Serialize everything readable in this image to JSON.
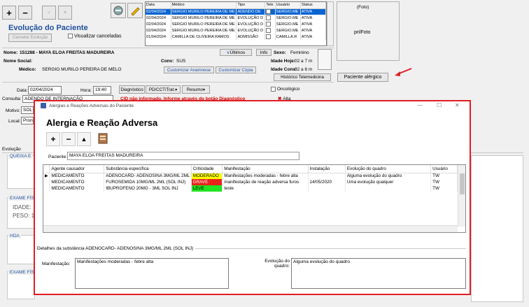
{
  "toolbar": {
    "add": "+",
    "remove": "−",
    "confirm": "✓",
    "cancel": "✕"
  },
  "page_title": "Evolução do Paciente",
  "cancel_evolution_label": "Cancelar Evolução",
  "view_cancelled_label": "Visualizar canceladas",
  "header_table": {
    "columns": [
      "Data",
      "Médico",
      "Tipo",
      "Tele",
      "Usuário",
      "Status"
    ],
    "rows": [
      [
        "02/04/2024",
        "SERGIO MURILO PEREIRA DE ME",
        "ADENDO DE",
        "",
        "SERGIO.ME",
        "ATIVA"
      ],
      [
        "02/04/2024",
        "SERGIO MURILO PEREIRA DE ME",
        "EVOLUÇÃO D",
        "",
        "SERGIO.ME",
        "ATIVA"
      ],
      [
        "02/04/2024",
        "SERGIO MURILO PEREIRA DE ME",
        "EVOLUÇÃO D",
        "",
        "SERGIO.ME",
        "ATIVA"
      ],
      [
        "02/04/2024",
        "SERGIO MURILO PEREIRA DE ME",
        "EVOLUÇÃO D",
        "",
        "SERGIO.ME",
        "ATIVA"
      ],
      [
        "01/04/2024",
        "CAMILLA DE OLIVEIRA RAMOS",
        "ADMISSÃO",
        "",
        "CAMILLA.R",
        "ATIVA"
      ]
    ]
  },
  "photo": {
    "caption": "(Foto)",
    "placeholder": "pnlFoto"
  },
  "allergy_button_label": "Paciente alérgico",
  "patient": {
    "name_label": "Nome:",
    "name_value": "151288 - MAYA ELOA FREITAS MADUREIRA",
    "social_label": "Nome Social:",
    "doctor_label": "Médico:",
    "doctor_value": "SERGIO MURILO PEREIRA DE MELO",
    "conv_label": "Conv:",
    "conv_value": "SUS",
    "last_button": "Últimos",
    "info_button": "Info",
    "sex_label": "Sexo:",
    "sex_value": "Feminino",
    "age_today_label": "Idade Hoje:",
    "age_today_value": "02 a 7 m",
    "age_cons_label": "Idade Cons:",
    "age_cons_value": "02 a 6 m",
    "custom_anamnese": "Customizar Anamnese",
    "custom_copy": "Customizar Cópia",
    "tele_history": "Histórico Telemedicina"
  },
  "form": {
    "date_label": "Data:",
    "date_value": "02/04/2024",
    "time_label": "Hora:",
    "time_value": "19:40",
    "diagnosis_button": "Diagnóstico",
    "pdcct_button": "PD/CCT/Trat.",
    "summary_button": "Resumo",
    "oncologic_label": "Oncológico",
    "cid_warning": "CID não informado. Informe através do botão Diagnóstico",
    "alta_label": "Alta",
    "consult_label": "Consulta:",
    "consult_value": "ADENDO DE INTERNAÇÃO",
    "motive_label": "Motivo:",
    "motive_value": "SOL",
    "local_label": "Local:",
    "local_value": "Pron",
    "evolution_label": "Evolução",
    "queixa_label": "QUEIXA E",
    "exame_label": "EXAME FÍS",
    "idade_label": "IDADE:",
    "peso_label": "PESO: 1",
    "hda_label": "HDA",
    "exame2_label": "EXAME FÍS"
  },
  "dialog": {
    "window_title": "Alergias e Reações Adversas do Paciente",
    "heading": "Alergia e Reação Adversa",
    "patient_label": "Paciente:",
    "patient_value": "MAYA ELOA FREITAS MADUREIRA",
    "columns": [
      "Agente causador",
      "Substância específica",
      "Criticidade",
      "Manifestação",
      "Instalação",
      "Evolução do quadro",
      "Usuário"
    ],
    "rows": [
      {
        "agent": "MEDICAMENTO",
        "substance": "ADENOCARD- ADENOSINA 3MG/ML 2ML (SOL INJ)",
        "criticality": "MODERADO",
        "crit_color": "#ffff00",
        "crit_text": "#000000",
        "manifestation": "Manifestações moderadas - febre alta",
        "installation": "",
        "evolution": "Alguma evolução do quadro",
        "user": "TW"
      },
      {
        "agent": "MEDICAMENTO",
        "substance": "FUROSEMIDA 10MG/ML 2ML (SOL INJ)",
        "criticality": "GRAVE",
        "crit_color": "#e8231b",
        "crit_text": "#ffffff",
        "manifestation": "manifestação de reação adversa furos",
        "installation": "14/05/2020",
        "evolution": "Uma evolução qualquer",
        "user": "TW"
      },
      {
        "agent": "MEDICAMENTO",
        "substance": "IBUPROFENO 20MG - 3ML SOL INJ",
        "criticality": "LEVE",
        "crit_color": "#21e321",
        "crit_text": "#000000",
        "manifestation": "teste",
        "installation": "",
        "evolution": "",
        "user": "TW"
      }
    ],
    "details_title": "Detalhes da substância ADENOCARD- ADENOSINA 3MG/ML 2ML (SOL INJ)",
    "manifestation_label": "Manifestação:",
    "manifestation_value": "Manifestações moderadas - febre alta",
    "evolution_label": "Evolução do quadro:",
    "evolution_value": "Alguma evolução do quadro"
  },
  "colors": {
    "accent": "#1f4f9f",
    "dialog_border": "#e11d24",
    "selected": "#0a64d2",
    "warning": "#d10000"
  }
}
